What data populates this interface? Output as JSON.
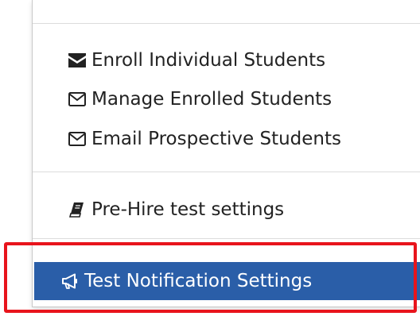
{
  "menu": {
    "group1": [
      {
        "label": "Enroll Individual Students",
        "icon": "envelope-filled-icon"
      },
      {
        "label": "Manage Enrolled Students",
        "icon": "envelope-outline-icon"
      },
      {
        "label": "Email Prospective Students",
        "icon": "envelope-outline-icon"
      }
    ],
    "group2": [
      {
        "label": "Pre-Hire test settings",
        "icon": "book-icon"
      }
    ],
    "active_item": {
      "label": "Test Notification Settings",
      "icon": "bullhorn-icon"
    }
  },
  "colors": {
    "active_bg": "#2a5ea8",
    "highlight": "#e8141c"
  }
}
